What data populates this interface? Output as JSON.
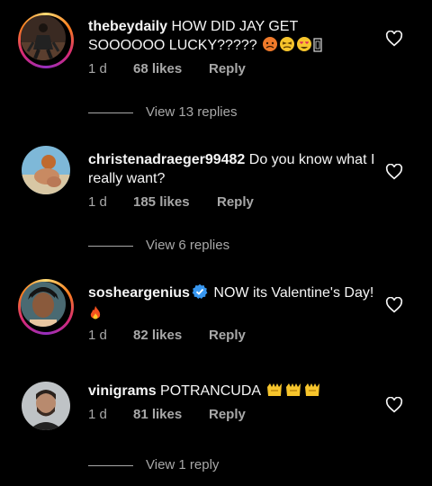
{
  "comments": [
    {
      "username": "thebeydaily",
      "text": "HOW DID JAY GET SOOOOOO LUCKY?????",
      "time": "1 d",
      "likes": "68 likes",
      "reply": "Reply",
      "view_replies": "View 13 replies",
      "avatar_icon": "profile-photo"
    },
    {
      "username": "christenadraeger99482",
      "text": "Do you know what I really want?",
      "time": "1 d",
      "likes": "185 likes",
      "reply": "Reply",
      "view_replies": "View 6 replies",
      "avatar_icon": "profile-photo"
    },
    {
      "username": "sosheargenius",
      "text": "NOW its Valentine's Day!",
      "time": "1 d",
      "likes": "82 likes",
      "reply": "Reply",
      "avatar_icon": "profile-photo",
      "verified": true
    },
    {
      "username": "vinigrams",
      "text": "POTRANCUDA",
      "time": "1 d",
      "likes": "81 likes",
      "reply": "Reply",
      "view_replies": "View 1 reply",
      "avatar_icon": "profile-photo"
    }
  ],
  "colors": {
    "background": "#000000",
    "primary_text": "#f5f5f5",
    "secondary_text": "#a8a8a8",
    "verified_blue": "#3897f0"
  }
}
